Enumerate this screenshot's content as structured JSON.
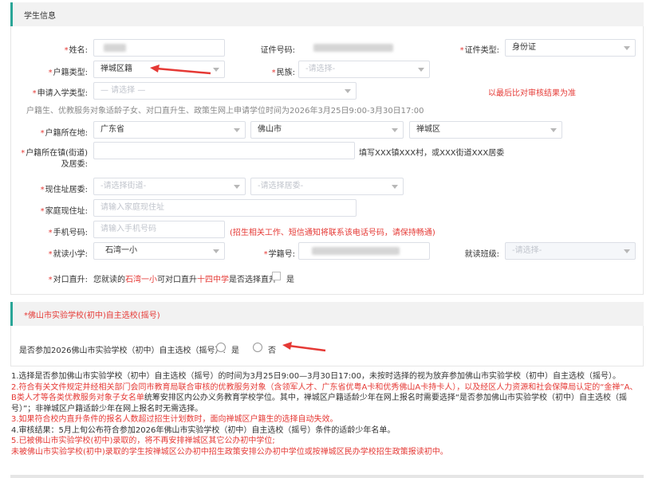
{
  "section1": {
    "title": "学生信息"
  },
  "fields": {
    "name_label": "*姓名:",
    "id_no_label": "证件号码:",
    "id_type_label": "*证件类型:",
    "id_type_value": "身份证",
    "hukou_type_label": "*户籍类型:",
    "hukou_type_value": "禅城区籍",
    "ethnicity_label": "*民族:",
    "ethnicity_placeholder": "-请选择-",
    "apply_type_label": "*申请入学类型:",
    "apply_type_placeholder": "— 请选择 —",
    "apply_note": "以最后比对审核结果为准",
    "apply_hint": "户籍生、优教服务对象适龄子女、对口直升生、政策生网上申请学位时间为2026年3月25日9:00-3月30日17:00",
    "hukou_loc_label": "*户籍所在地:",
    "province": "广东省",
    "city": "佛山市",
    "district": "禅城区",
    "town_label_1": "*户籍所在镇(街道)",
    "town_label_2": "及居委:",
    "town_hint": "填写XXX镇XXX村，或XXX街道XXX居委",
    "current_label": "*现住址居委:",
    "street_placeholder": "-请选择街道-",
    "committee_placeholder": "-请选择居委-",
    "home_addr_label": "*家庭现住址:",
    "home_addr_placeholder": "请输入家庭现住址",
    "phone_label": "*手机号码:",
    "phone_placeholder": "请输入手机号码",
    "phone_note": "(招生相关工作、短信通知将联系该电话号码，请保持畅通)",
    "school_label": "*就读小学:",
    "school_value": "石湾一小",
    "stu_no_label": "*学籍号:",
    "class_label": "就读班级:",
    "class_placeholder": "-请选择-",
    "direct_label": "*对口直升:",
    "direct_pre": "您就读的",
    "direct_school": "石湾一小",
    "direct_mid": "可对口直升",
    "direct_target": "十四中学",
    "direct_post": "是否选择直升",
    "direct_yes": "是"
  },
  "section2": {
    "title": "*佛山市实验学校(初中)自主选校(摇号)",
    "question": "是否参加2026佛山市实验学校（初中）自主选校（摇号）:",
    "opt_yes": "是",
    "opt_no": "否"
  },
  "rules": {
    "r1": "1.选择是否参加佛山市实验学校（初中）自主选校（摇号）的时间为3月25日9:00—3月30日17:00，未按时选择的视为放弃参加佛山市实验学校（初中）自主选校（摇号）。",
    "r2_red": "2.符合有关文件规定并经相关部门会同市教育局联合审核的优教服务对象（含领军人才、广东省优粤A卡和优秀佛山A卡持卡人），以及经区人力资源和社会保障局认定的“金禅”A、B类人才等各类优教服务对象子女名单",
    "r2_black": "统筹安排区内公办义务教育学校学位。其中，禅城区户籍适龄少年在网上报名时需要选择“是否参加佛山市实验学校（初中）自主选校（摇号）”；非禅城区户籍适龄少年在网上报名时无需选择。",
    "r3": "3.如果符合校内直升条件的报名人数超过招生计划数时，面向禅城区户籍生的选择自动失效。",
    "r4": "4.审核结果：5月上旬公布符合参加2026年佛山市实验学校（初中）自主选校（摇号）条件的适龄少年名单。",
    "r5a": "5.已被佛山市实验学校(初中)录取的，将不再安排禅城区其它公办初中学位;",
    "r5b": "未被佛山市实验学校(初中)录取的学生按禅城区公办初中招生政策安排公办初中学位或按禅城区民办学校招生政策报读初中。"
  },
  "colors": {
    "accent": "#2aa597",
    "required": "#e53935",
    "arrow": "#e53935"
  }
}
